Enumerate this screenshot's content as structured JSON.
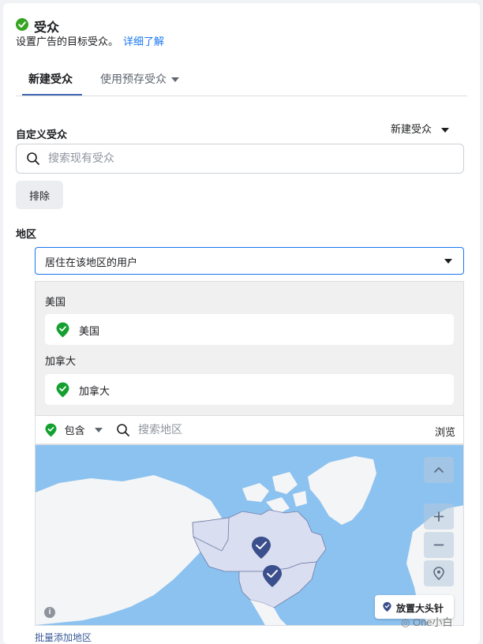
{
  "header": {
    "title": "受众",
    "subtitle": "设置广告的目标受众。",
    "learn_more": "详细了解"
  },
  "tabs": [
    {
      "label": "新建受众",
      "active": true
    },
    {
      "label": "使用预存受众",
      "active": false
    }
  ],
  "custom_audience": {
    "label": "自定义受众",
    "create_new": "新建受众",
    "search_placeholder": "搜索现有受众",
    "exclude_label": "排除"
  },
  "location": {
    "label": "地区",
    "selected_type": "居住在该地区的用户",
    "groups": [
      {
        "title": "美国",
        "items": [
          "美国"
        ]
      },
      {
        "title": "加拿大",
        "items": [
          "加拿大"
        ]
      }
    ],
    "include_label": "包含",
    "search_placeholder": "搜索地区",
    "browse_label": "浏览",
    "drop_pin_label": "放置大头针",
    "bulk_add_label": "批量添加地区"
  },
  "watermark": "One小白",
  "colors": {
    "accent": "#1877f2",
    "tab_underline": "#4267b2",
    "include_green": "#14a030",
    "map_ocean": "#8cc2f0",
    "map_land": "#f4f5f6",
    "map_selected": "#d9def0",
    "marker": "#3b4f8c"
  }
}
